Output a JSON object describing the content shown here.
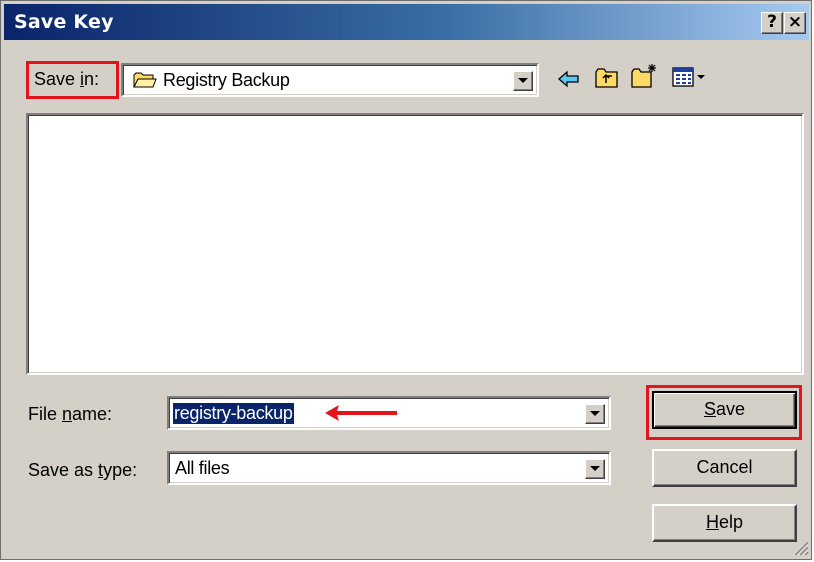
{
  "window": {
    "title": "Save Key"
  },
  "titlebar_buttons": {
    "help": "?",
    "close": "×"
  },
  "save_in": {
    "label_prefix": "Save ",
    "label_accel": "i",
    "label_suffix": "n:",
    "value": "Registry Backup"
  },
  "toolbar": {
    "icons": [
      "back-icon",
      "up-folder-icon",
      "new-folder-icon",
      "view-menu-icon"
    ]
  },
  "file_name": {
    "label_prefix": "File ",
    "label_accel": "n",
    "label_suffix": "ame:",
    "value": "registry-backup"
  },
  "save_as_type": {
    "label_prefix": "Save as ",
    "label_accel": "t",
    "label_suffix": "ype:",
    "value": "All files"
  },
  "buttons": {
    "save_accel": "S",
    "save_rest": "ave",
    "cancel": "Cancel",
    "help_accel": "H",
    "help_rest": "elp"
  },
  "annotations": {
    "highlight_color": "#e3141b"
  }
}
